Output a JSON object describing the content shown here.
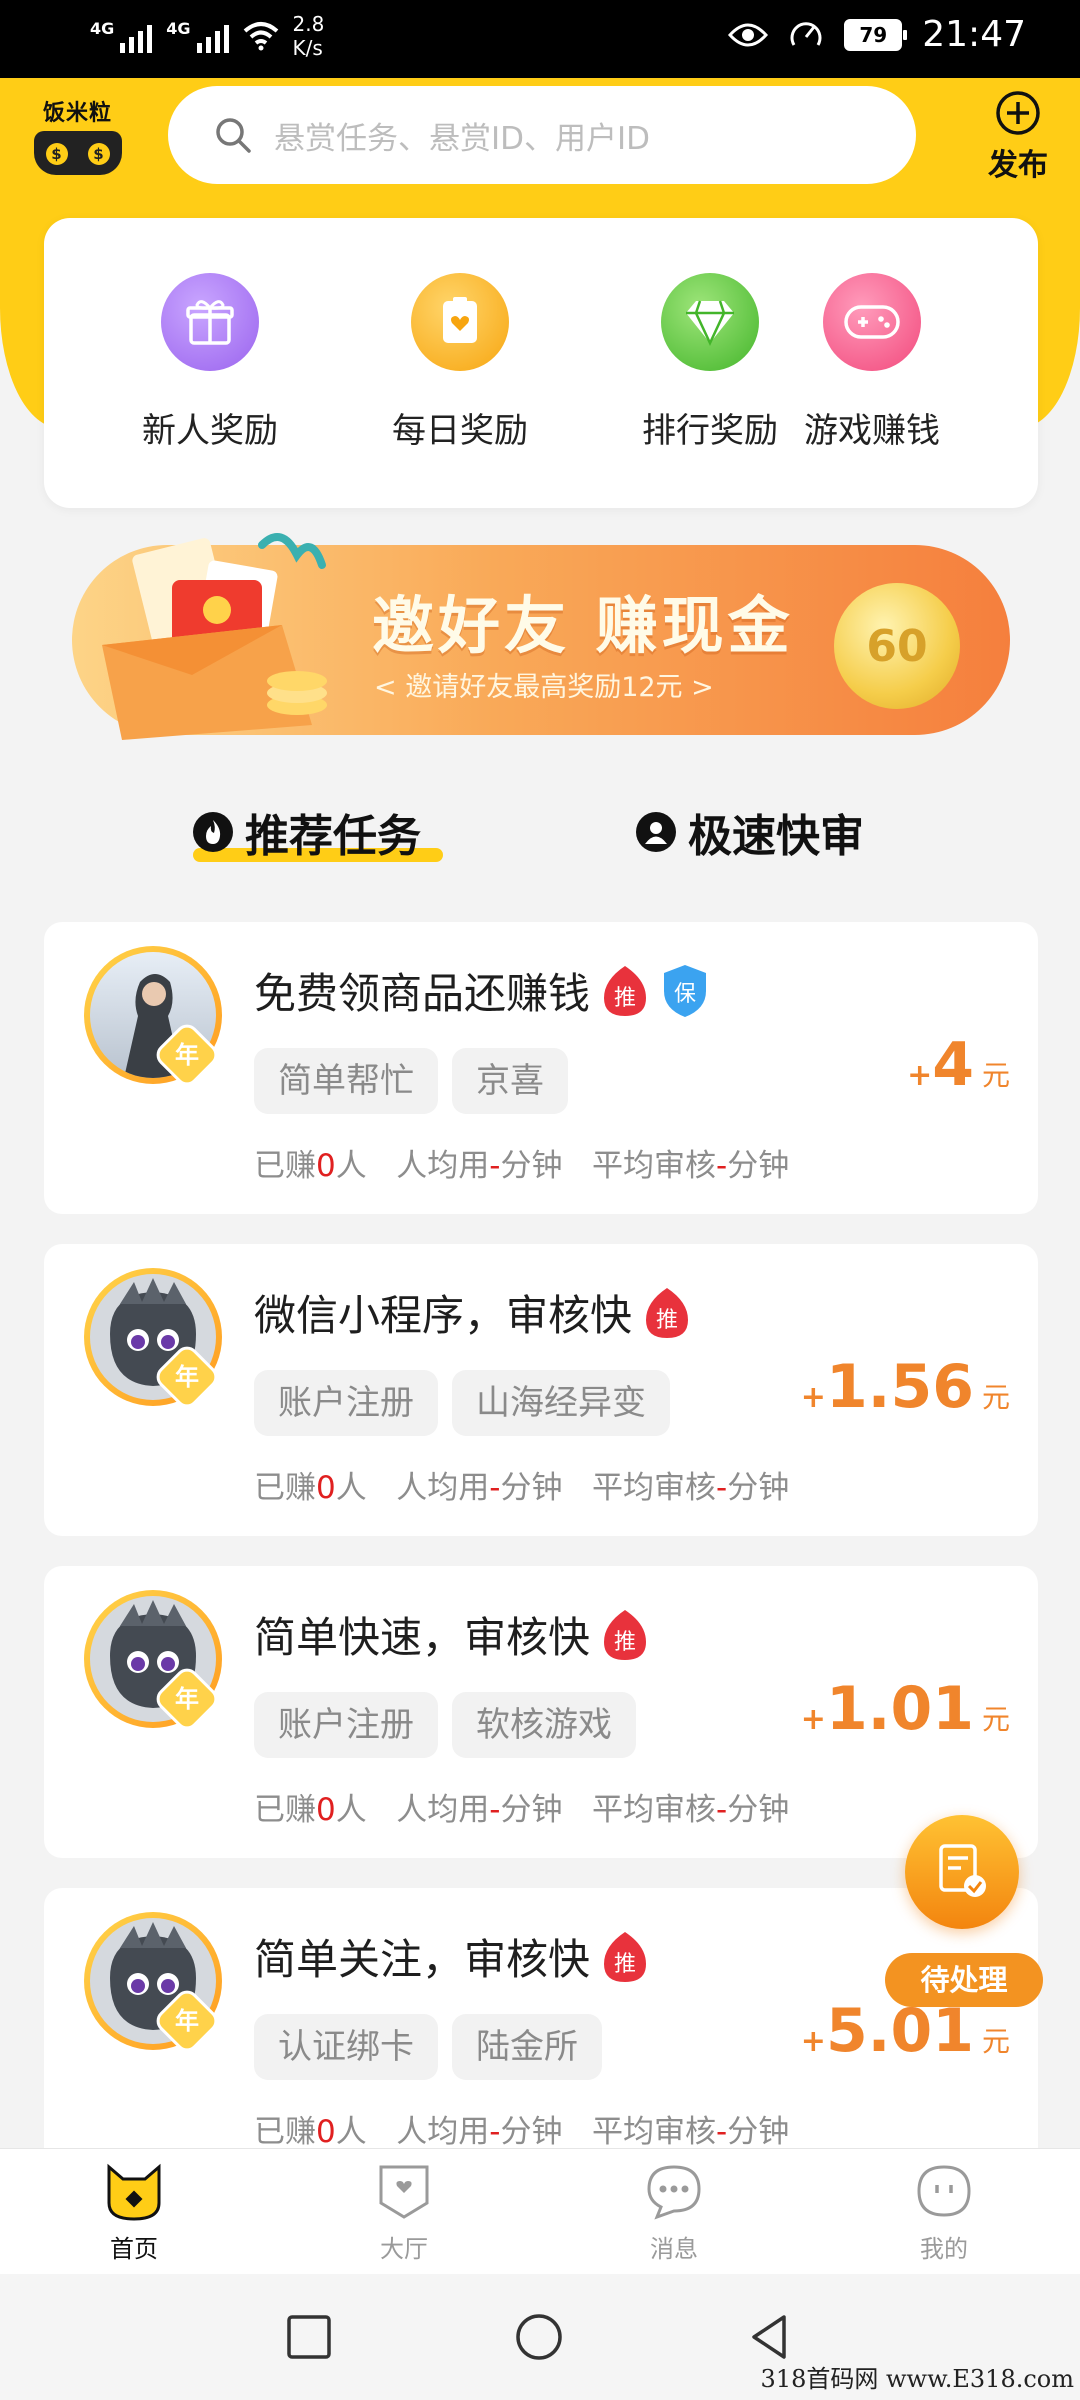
{
  "status_bar": {
    "net1": "4G",
    "net2": "4G",
    "speed_value": "2.8",
    "speed_unit": "K/s",
    "battery": "79",
    "time": "21:47"
  },
  "header": {
    "logo_text": "饭米粒",
    "search_placeholder": "悬赏任务、悬赏ID、用户ID",
    "publish_label": "发布"
  },
  "quick_entries": [
    {
      "label": "新人奖励",
      "icon": "gift-icon",
      "color": "#a474f0"
    },
    {
      "label": "每日奖励",
      "icon": "daily-card-icon",
      "color": "#f9b21e"
    },
    {
      "label": "排行奖励",
      "icon": "diamond-icon",
      "color": "#55c23a"
    },
    {
      "label": "游戏赚钱",
      "icon": "gamepad-icon",
      "color": "#f55d8d"
    }
  ],
  "banner": {
    "title": "邀好友  赚现金",
    "subtitle": "< 邀请好友最高奖励12元 >",
    "coin_text": "60"
  },
  "tabs": [
    {
      "label": "推荐任务",
      "active": true,
      "icon": "fire-icon"
    },
    {
      "label": "极速快审",
      "active": false,
      "icon": "user-icon"
    }
  ],
  "tasks": [
    {
      "title": "免费领商品还赚钱",
      "badges": [
        "推",
        "保"
      ],
      "tags": [
        "简单帮忙",
        "京喜"
      ],
      "reward": "4",
      "plus": "+",
      "unit": "元",
      "earned_label": "已赚",
      "earned": "0",
      "earned_unit": "人",
      "avg_use": "人均用",
      "avg_use_value": "-",
      "avg_review": "平均审核",
      "avg_review_value": "-",
      "minute": "分钟",
      "year": "年"
    },
    {
      "title": "微信小程序，审核快",
      "badges": [
        "推"
      ],
      "tags": [
        "账户注册",
        "山海经异变"
      ],
      "reward": "1.56",
      "plus": "+",
      "unit": "元",
      "earned_label": "已赚",
      "earned": "0",
      "earned_unit": "人",
      "avg_use": "人均用",
      "avg_use_value": "-",
      "avg_review": "平均审核",
      "avg_review_value": "-",
      "minute": "分钟",
      "year": "年"
    },
    {
      "title": "简单快速，审核快",
      "badges": [
        "推"
      ],
      "tags": [
        "账户注册",
        "软核游戏"
      ],
      "reward": "1.01",
      "plus": "+",
      "unit": "元",
      "earned_label": "已赚",
      "earned": "0",
      "earned_unit": "人",
      "avg_use": "人均用",
      "avg_use_value": "-",
      "avg_review": "平均审核",
      "avg_review_value": "-",
      "minute": "分钟",
      "year": "年"
    },
    {
      "title": "简单关注，审核快",
      "badges": [
        "推"
      ],
      "tags": [
        "认证绑卡",
        "陆金所"
      ],
      "reward": "5.01",
      "plus": "+",
      "unit": "元",
      "earned_label": "已赚",
      "earned": "0",
      "earned_unit": "人",
      "avg_use": "人均用",
      "avg_use_value": "-",
      "avg_review": "平均审核",
      "avg_review_value": "-",
      "minute": "分钟",
      "year": "年"
    }
  ],
  "pending": {
    "label": "待处理"
  },
  "bottom_nav": [
    {
      "label": "首页",
      "active": true
    },
    {
      "label": "大厅",
      "active": false
    },
    {
      "label": "消息",
      "active": false
    },
    {
      "label": "我的",
      "active": false
    }
  ],
  "watermark": "318首码网  www.E318.com",
  "colors": {
    "accent": "#ffcd16",
    "reward": "#f0852c",
    "badge_red": "#e8323c",
    "badge_blue": "#3ba3f0"
  }
}
